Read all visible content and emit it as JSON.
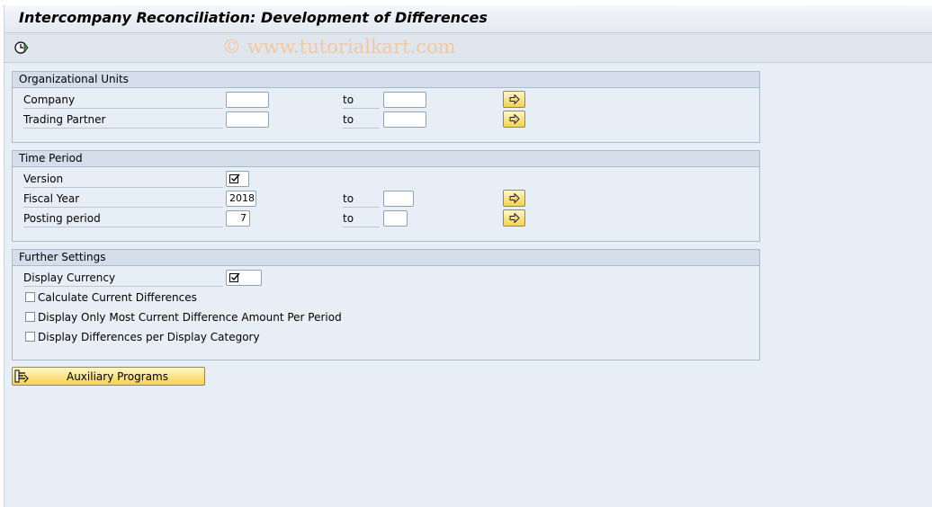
{
  "window": {
    "title": "Intercompany Reconciliation: Development of Differences"
  },
  "toolbar": {
    "execute_icon": "clock-execute-icon",
    "watermark": "© www.tutorialkart.com"
  },
  "org_units": {
    "header": "Organizational Units",
    "rows": [
      {
        "label": "Company",
        "from": "",
        "to_label": "to",
        "to": "",
        "more_icon": "arrow-right-icon"
      },
      {
        "label": "Trading Partner",
        "from": "",
        "to_label": "to",
        "to": "",
        "more_icon": "arrow-right-icon"
      }
    ]
  },
  "time_period": {
    "header": "Time Period",
    "version": {
      "label": "Version",
      "icon": "checkbox-selected-icon"
    },
    "fiscal_year": {
      "label": "Fiscal Year",
      "from": "2018",
      "to_label": "to",
      "to": ""
    },
    "posting_period": {
      "label": "Posting period",
      "from": "7",
      "to_label": "to",
      "to": ""
    }
  },
  "further_settings": {
    "header": "Further Settings",
    "display_currency": {
      "label": "Display Currency",
      "icon": "checkbox-selected-icon"
    },
    "options": [
      {
        "label": "Calculate Current Differences",
        "checked": false
      },
      {
        "label": "Display Only Most Current Difference Amount Per Period",
        "checked": false
      },
      {
        "label": "Display Differences per Display Category",
        "checked": false
      }
    ]
  },
  "aux_button": {
    "label": "Auxiliary Programs",
    "icon": "programs-icon"
  },
  "colors": {
    "button_yellow": "#f5d34f",
    "panel_bg": "#e8eef5",
    "group_header": "#d3deea"
  }
}
